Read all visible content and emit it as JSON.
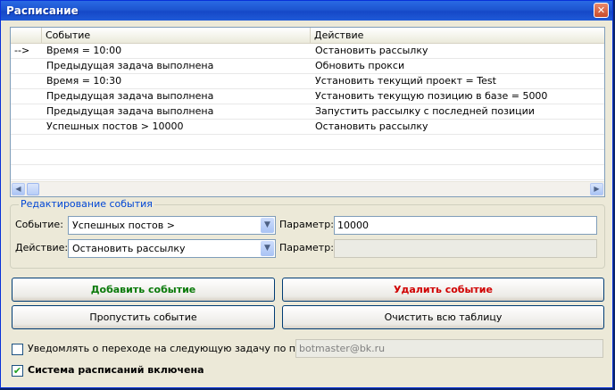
{
  "window": {
    "title": "Расписание",
    "close_icon": "close-icon"
  },
  "grid": {
    "columns": [
      "Событие",
      "Действие"
    ],
    "rows": [
      {
        "marker": "-->",
        "event": "Время = 10:00",
        "action": "Остановить рассылку"
      },
      {
        "marker": "",
        "event": "Предыдущая задача выполнена",
        "action": "Обновить прокси"
      },
      {
        "marker": "",
        "event": "Время = 10:30",
        "action": "Установить текущий проект = Test"
      },
      {
        "marker": "",
        "event": "Предыдущая задача выполнена",
        "action": "Установить текущую позицию в базе = 5000"
      },
      {
        "marker": "",
        "event": "Предыдущая задача выполнена",
        "action": "Запустить рассылку с последней позиции"
      },
      {
        "marker": "",
        "event": "Успешных постов > 10000",
        "action": "Остановить рассылку"
      }
    ]
  },
  "editor": {
    "legend": "Редактирование события",
    "event_label": "Событие:",
    "event_value": "Успешных постов >",
    "action_label": "Действие:",
    "action_value": "Остановить рассылку",
    "param1_label": "Параметр:",
    "param1_value": "10000",
    "param2_label": "Параметр:",
    "param2_value": ""
  },
  "buttons": {
    "add": "Добавить событие",
    "delete": "Удалить событие",
    "skip": "Пропустить событие",
    "clear": "Очистить всю таблицу"
  },
  "notify": {
    "label": "Уведомлять о переходе на следующую задачу по почте:",
    "checked": false,
    "email": "botmaster@bk.ru"
  },
  "scheduler": {
    "label": "Система расписаний включена",
    "checked": true
  },
  "colors": {
    "add_button": "#0a7a0a",
    "delete_button": "#d00000",
    "legend": "#0046d5"
  }
}
